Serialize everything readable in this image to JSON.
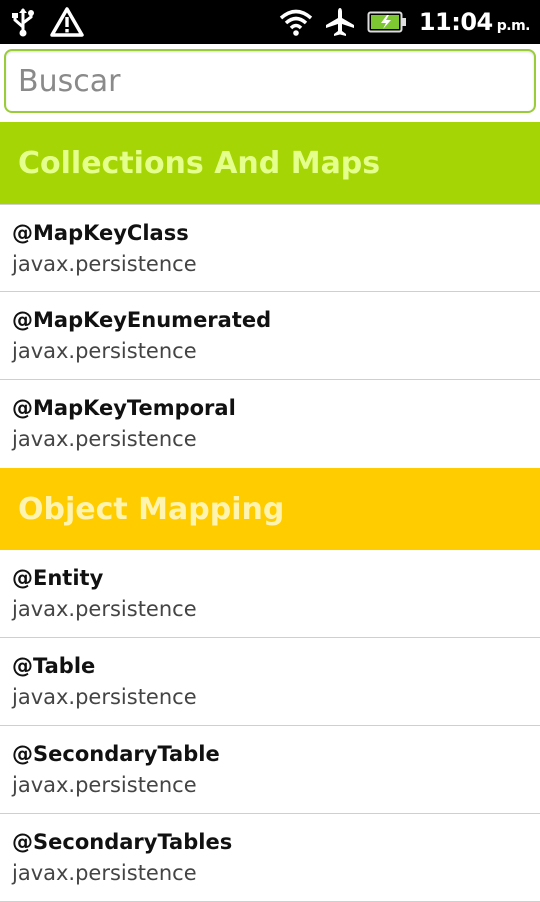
{
  "status_bar": {
    "time": "11:04",
    "ampm": "p.m.",
    "icons": [
      "usb-icon",
      "warning-icon",
      "wifi-icon",
      "airplane-icon",
      "battery-charging-icon"
    ]
  },
  "search": {
    "placeholder": "Buscar",
    "value": ""
  },
  "colors": {
    "accent_green": "#a6d505",
    "accent_yellow": "#ffcc00",
    "search_border": "#9acc3a"
  },
  "sections": [
    {
      "title": "Collections And Maps",
      "items": [
        {
          "title": "@MapKeyClass",
          "subtitle": "javax.persistence"
        },
        {
          "title": "@MapKeyEnumerated",
          "subtitle": "javax.persistence"
        },
        {
          "title": "@MapKeyTemporal",
          "subtitle": "javax.persistence"
        }
      ]
    },
    {
      "title": "Object Mapping",
      "items": [
        {
          "title": "@Entity",
          "subtitle": "javax.persistence"
        },
        {
          "title": "@Table",
          "subtitle": "javax.persistence"
        },
        {
          "title": "@SecondaryTable",
          "subtitle": "javax.persistence"
        },
        {
          "title": "@SecondaryTables",
          "subtitle": "javax.persistence"
        }
      ]
    }
  ]
}
